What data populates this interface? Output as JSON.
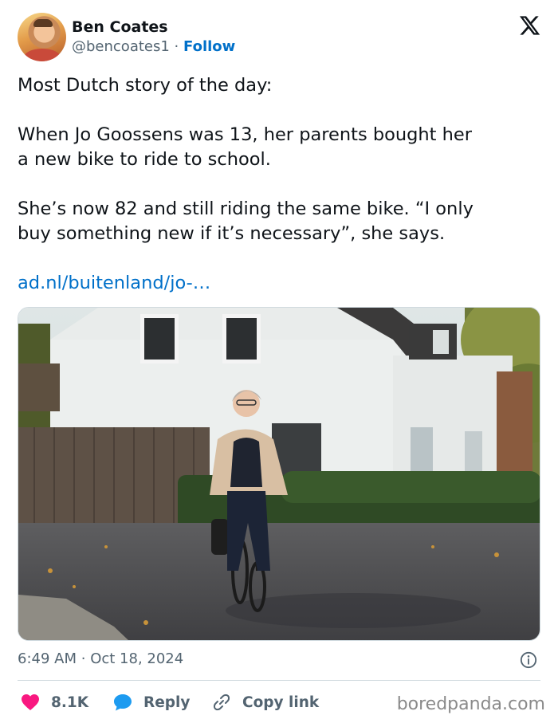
{
  "author": {
    "name": "Ben Coates",
    "handle": "@bencoates1",
    "separator": "·",
    "follow_label": "Follow",
    "avatar_icon": "profile-photo"
  },
  "tweet": {
    "paragraphs": [
      "Most Dutch story of the day:",
      "When Jo Goossens was 13, her parents bought her\na new bike to ride to school.",
      "She’s now 82 and still riding the same bike. “I only\nbuy something new if it’s necessary”, she says."
    ],
    "link_text": "ad.nl/buitenland/jo-…"
  },
  "media": {
    "icon": "photo-woman-cycling"
  },
  "meta": {
    "time": "6:49 AM",
    "separator": "·",
    "date": "Oct 18, 2024",
    "info_icon": "info-icon"
  },
  "actions": {
    "like_count": "8.1K",
    "reply_label": "Reply",
    "copy_link_label": "Copy link",
    "like_color": "#f91880",
    "reply_color": "#1d9bf0"
  },
  "watermark": "boredpanda.com",
  "colors": {
    "link": "#0070c9",
    "secondary_text": "#536471",
    "primary_text": "#0f1419"
  }
}
